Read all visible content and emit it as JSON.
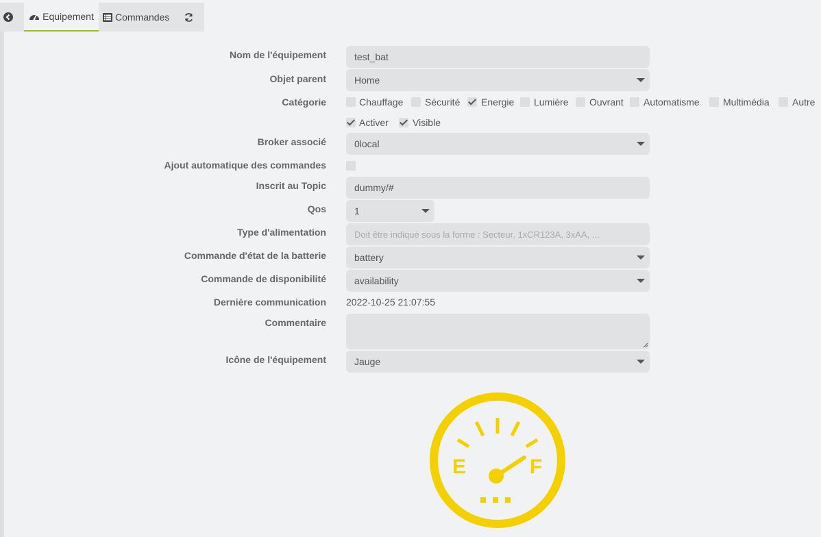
{
  "tabs": [
    {
      "label": "Equipement",
      "icon": "dashboard-icon",
      "active": true
    },
    {
      "label": "Commandes",
      "icon": "list-icon",
      "active": false
    }
  ],
  "form": {
    "name_label": "Nom de l'équipement",
    "name_value": "test_bat",
    "parent_label": "Objet parent",
    "parent_value": "Home",
    "category_label": "Catégorie",
    "categories": [
      {
        "label": "Chauffage",
        "checked": false
      },
      {
        "label": "Sécurité",
        "checked": false
      },
      {
        "label": "Energie",
        "checked": true
      },
      {
        "label": "Lumière",
        "checked": false
      },
      {
        "label": "Ouvrant",
        "checked": false
      },
      {
        "label": "Automatisme",
        "checked": false
      },
      {
        "label": "Multimédia",
        "checked": false
      },
      {
        "label": "Autre",
        "checked": false
      }
    ],
    "activate_label": "Activer",
    "visible_label": "Visible",
    "broker_label": "Broker associé",
    "broker_value": "0local",
    "autoadd_label": "Ajout automatique des commandes",
    "topic_label": "Inscrit au Topic",
    "topic_value": "dummy/#",
    "qos_label": "Qos",
    "qos_value": "1",
    "power_label": "Type d'alimentation",
    "power_placeholder": "Doit être indiqué sous la forme : Secteur, 1xCR123A, 3xAA, ...",
    "battery_label": "Commande d'état de la batterie",
    "battery_value": "battery",
    "availability_label": "Commande de disponibilité",
    "availability_value": "availability",
    "lastcomm_label": "Dernière communication",
    "lastcomm_value": "2022-10-25 21:07:55",
    "comment_label": "Commentaire",
    "icon_label": "Icône de l'équipement",
    "icon_value": "Jauge"
  },
  "gauge": {
    "empty_letter": "E",
    "full_letter": "F",
    "color": "#f5d000"
  }
}
